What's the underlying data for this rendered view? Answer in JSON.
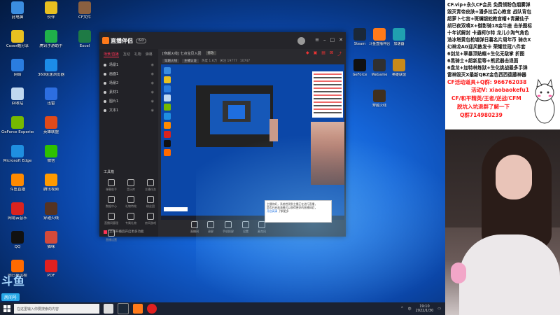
{
  "desktop": {
    "icons_col1": [
      {
        "label": "此电脑",
        "color": "#3b8de0"
      },
      {
        "label": "Coser酷分享",
        "color": "#e8c020"
      },
      {
        "label": "网络",
        "color": "#2a7de0"
      },
      {
        "label": "回收站",
        "color": "#c0d8f0"
      },
      {
        "label": "GeForce Experience",
        "color": "#76b900"
      },
      {
        "label": "Microsoft Edge",
        "color": "#1f8fe0"
      },
      {
        "label": "斗鱼直播",
        "color": "#ff8a00"
      },
      {
        "label": "网易云音乐",
        "color": "#d9231f"
      },
      {
        "label": "QQ",
        "color": "#111111"
      },
      {
        "label": "向日葵远程",
        "color": "#ff6a00"
      }
    ],
    "icons_col2": [
      {
        "label": "伙伴",
        "color": "#e8c020"
      },
      {
        "label": "腾讯手游助手",
        "color": "#1fb04a"
      },
      {
        "label": "360极速浏览器",
        "color": "#1c8ce8"
      },
      {
        "label": "迅雷",
        "color": "#2d6ee0"
      },
      {
        "label": "英雄联盟",
        "color": "#e04a1a"
      },
      {
        "label": "微信",
        "color": "#2ec100"
      },
      {
        "label": "腾讯视频",
        "color": "#ff9a00"
      },
      {
        "label": "穿越火线",
        "color": "#553322"
      },
      {
        "label": "猫咪",
        "color": "#d24a3a"
      },
      {
        "label": "PDF",
        "color": "#e02020"
      }
    ],
    "icons_col3": [
      {
        "label": "CF文件",
        "color": "#8a6040"
      },
      {
        "label": "Excel",
        "color": "#1e7a45"
      }
    ],
    "icons_right": [
      {
        "label": "Steam",
        "color": "#1b2838"
      },
      {
        "label": "斗鱼直播伴侣",
        "color": "#ff7a1a"
      },
      {
        "label": "加速器",
        "color": "#20a0b0"
      },
      {
        "label": "GeForce",
        "color": "#111111"
      },
      {
        "label": "WeGame",
        "color": "#303030"
      },
      {
        "label": "英雄联盟",
        "color": "#c88a1a"
      },
      {
        "label": "",
        "color": "#00000000"
      },
      {
        "label": "穿越火线",
        "color": "#40301f"
      },
      {
        "label": "",
        "color": "#00000000"
      }
    ],
    "watermark": {
      "logo": "斗鱼",
      "room_label": "房间号",
      "room_number": "10747"
    }
  },
  "taskbar": {
    "search_placeholder": "在这里输入你要搜索的内容",
    "time": "19:10",
    "date": "2022/1/30",
    "tray_text": "中"
  },
  "app": {
    "logo_text": "直播伴侣",
    "version": "6.0",
    "left_tabs": [
      "场景/直播",
      "互动",
      "礼物",
      "弹幕"
    ],
    "scenes": [
      "场景1",
      "画面1",
      "场景2",
      "素材1",
      "图片1",
      "文本1"
    ],
    "toolbox_title": "工具箱",
    "tools": [
      "弹幕助手",
      "音乐库",
      "主播任务",
      "数据中心",
      "礼物特效",
      "粉丝团",
      "直播间管理",
      "专属礼物",
      "房间游戏",
      "直播设置"
    ],
    "bottom_note": "立即开播后开启更多功能",
    "room_name": "[穿越火线] 七点宝贝入团",
    "room_edit": "修改",
    "room_stats": [
      "热度 1.6万",
      "关注 19777",
      "10747"
    ],
    "room_sub": [
      "穿越火线",
      "主播认证"
    ],
    "bottom_controls": [
      "直播间",
      "录屏",
      "手机投屏",
      "设置",
      "麦克风"
    ],
    "popup_line1": "主播你好，系统检测到主播正在进行直播，",
    "popup_line2": "是否开启高清模式以获得更好的直播体验，",
    "popup_link": "开启高清",
    "popup_line3": "了解更多"
  },
  "promo": {
    "lines": [
      "CF.vip+永久CF会员  免费领粉色烟雾弹",
      "毁灭青帝皮肤+潘多拉后心教官 战队背包",
      "超萝卜七宫+斑斓银蛇教官帽+青藏仙子",
      "胡已夜双嗅X+御影骑18金牛座 击杀图标",
      "十年试解封 卡通柯尔特 龙儿小淘气角色",
      "浩冰塔黄包枪墟弹日暮名片周年币 骑衣X",
      "幻神龙AG迎风散发卡 荣耀世冠八件套",
      "6剑龙+翠暴顶贴蝶+生化无敌掌 折图",
      "6黑骑士+超新星等+熊武器击退面",
      "6盘龙+加特林炼狱+生化挑战最多手弹",
      "雷神毁灭X最新QBZ金色西西德藤神器"
    ],
    "highlight_1": "CF活动道具+Q群: 966762038",
    "highlight_2": "活动V: xiaobaokefu1",
    "highlight_3": "CF/和平精英/王者/逆战/CFM",
    "highlight_4": "脱坑入坑退群了解一下",
    "highlight_5": "Q群714980239"
  },
  "colors": {
    "accent": "#ff7a1a",
    "promo_red": "#ff1a1a",
    "desktop_blue": "#1565d8"
  }
}
